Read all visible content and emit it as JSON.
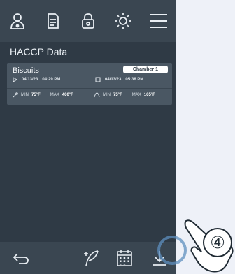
{
  "header": {
    "icons": [
      "profile-icon",
      "document-icon",
      "lock-icon",
      "brightness-icon",
      "menu-icon"
    ]
  },
  "page": {
    "title": "HACCP Data"
  },
  "record": {
    "name": "Biscuits",
    "badge": "Chamber 1",
    "start": {
      "date": "04/13/23",
      "time": "04:29 PM"
    },
    "end": {
      "date": "04/13/23",
      "time": "05:38 PM"
    },
    "probe": {
      "min_label": "MIN",
      "min_value": "75°F",
      "max_label": "MAX",
      "max_value": "400°F"
    },
    "chamber": {
      "min_label": "MIN",
      "min_value": "75°F",
      "max_label": "MAX",
      "max_value": "165°F"
    }
  },
  "footer": {
    "icons": [
      "back-icon",
      "feather-icon",
      "calendar-icon",
      "download-icon"
    ]
  },
  "callout": {
    "step": "④"
  },
  "colors": {
    "background": "#2f3a45",
    "bars": "#3a4651",
    "card": "#4a5763",
    "accent": "#ffffff"
  }
}
